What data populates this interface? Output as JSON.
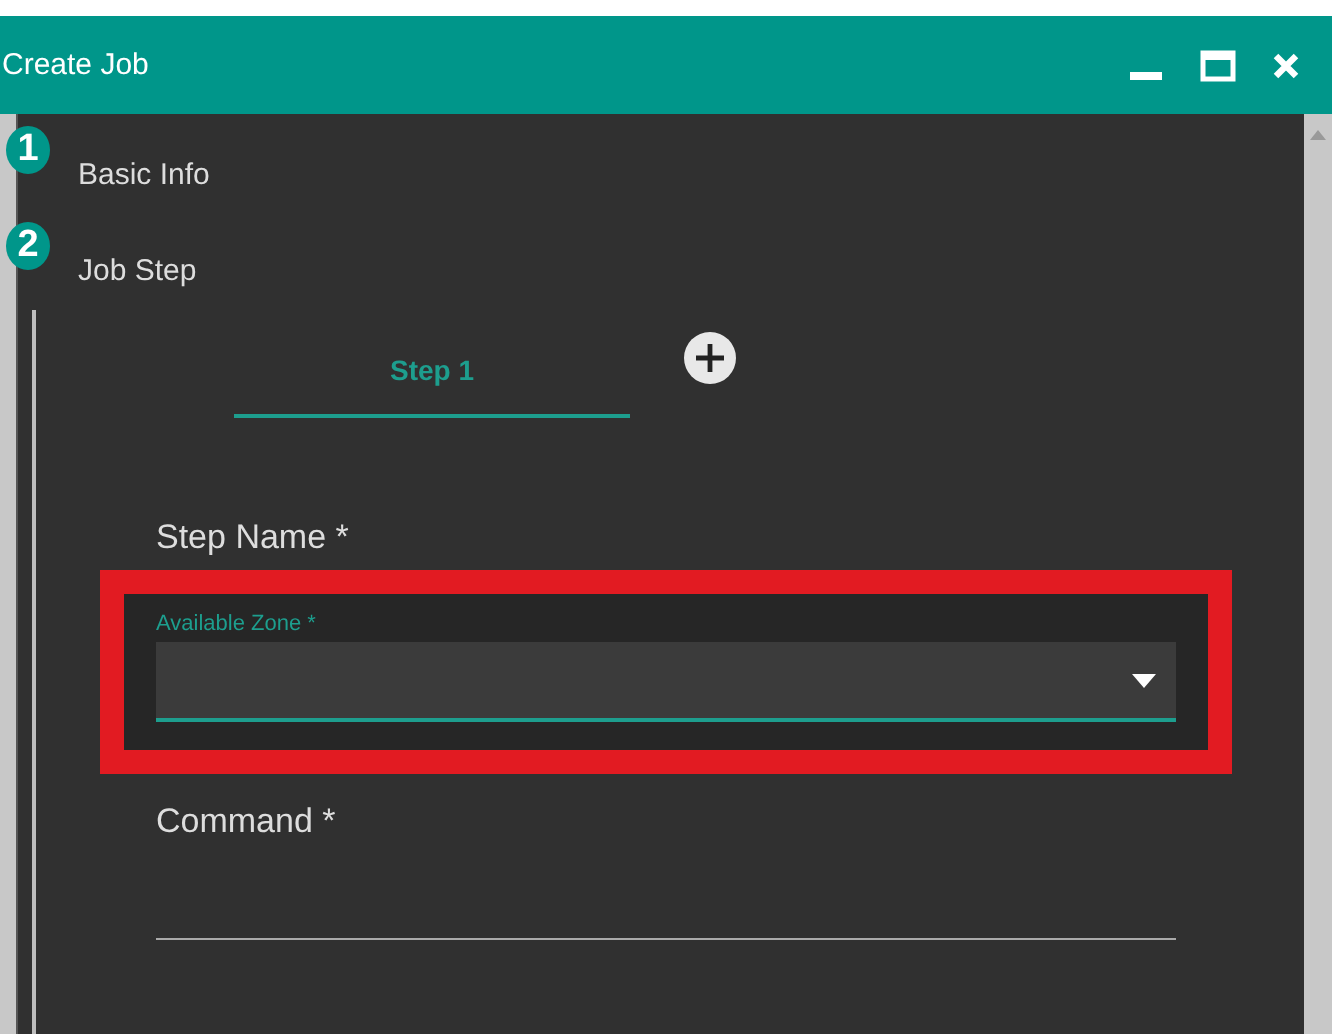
{
  "window": {
    "title": "Create Job"
  },
  "steps": [
    {
      "number": "1",
      "label": "Basic Info"
    },
    {
      "number": "2",
      "label": "Job Step"
    }
  ],
  "step_tabs": [
    {
      "label": "Step 1",
      "selected": true
    }
  ],
  "fields": [
    {
      "kind": "text",
      "label": "Step Name *",
      "highlighted": false
    },
    {
      "kind": "select",
      "label": "Available Zone *",
      "highlighted": true,
      "focused": true
    },
    {
      "kind": "text",
      "label": "Command *",
      "highlighted": false
    }
  ]
}
